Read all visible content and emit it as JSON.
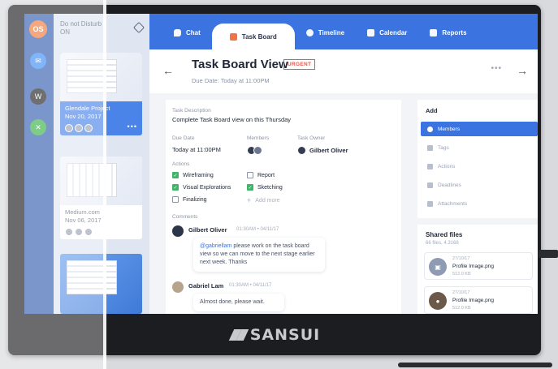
{
  "brand": "SANSUI",
  "rail": {
    "avatar_initials": "OS"
  },
  "sidebar": {
    "dnd_line1": "Do not Disturb",
    "dnd_line2": "ON",
    "projects": [
      {
        "name": "Glendale Project",
        "date": "Nov 20, 2017"
      },
      {
        "name": "Medium.com",
        "date": "Nov 06, 2017"
      }
    ]
  },
  "nav": {
    "tabs": [
      {
        "label": "Chat"
      },
      {
        "label": "Task Board"
      },
      {
        "label": "Timeline"
      },
      {
        "label": "Calendar"
      },
      {
        "label": "Reports"
      }
    ],
    "active": "Task Board"
  },
  "header": {
    "title": "Task Board View",
    "badge": "URGENT",
    "due": "Due Date: Today at 11:00PM"
  },
  "task": {
    "description_label": "Task Description",
    "description": "Complete Task Board view on this Thursday",
    "due_label": "Due Date",
    "due_value": "Today at 11:00PM",
    "members_label": "Members",
    "owner_label": "Task Owner",
    "owner": "Gilbert Oliver",
    "actions_label": "Actions",
    "actions": [
      {
        "label": "Wireframing",
        "checked": true
      },
      {
        "label": "Visual Explorations",
        "checked": true
      },
      {
        "label": "Finalizing",
        "checked": false
      },
      {
        "label": "Report",
        "checked": false
      },
      {
        "label": "Sketching",
        "checked": true
      }
    ],
    "add_more": "Add more",
    "comments_label": "Comments",
    "comments": [
      {
        "name": "Gilbert Oliver",
        "time": "01:30AM • 04/11/17",
        "mention": "@gabriellam",
        "text": " please work on the task board view so we can move to the next stage earlier next week. Thanks"
      },
      {
        "name": "Gabriel Lam",
        "time": "01:30AM • 04/11/17",
        "text": "Almost done, please wait."
      }
    ]
  },
  "add_panel": {
    "title": "Add",
    "options": [
      {
        "label": "Members",
        "active": true
      },
      {
        "label": "Tags",
        "active": false
      },
      {
        "label": "Actions",
        "active": false
      },
      {
        "label": "Deadlines",
        "active": false
      },
      {
        "label": "Attachments",
        "active": false
      }
    ]
  },
  "shared_files": {
    "title": "Shared files",
    "subtitle": "66 files, 4.3168",
    "files": [
      {
        "date": "27/10/17",
        "name": "Profile Image.png",
        "size": "512.0 KB"
      },
      {
        "date": "27/10/17",
        "name": "Profile Image.png",
        "size": "512.0 KB"
      }
    ]
  }
}
